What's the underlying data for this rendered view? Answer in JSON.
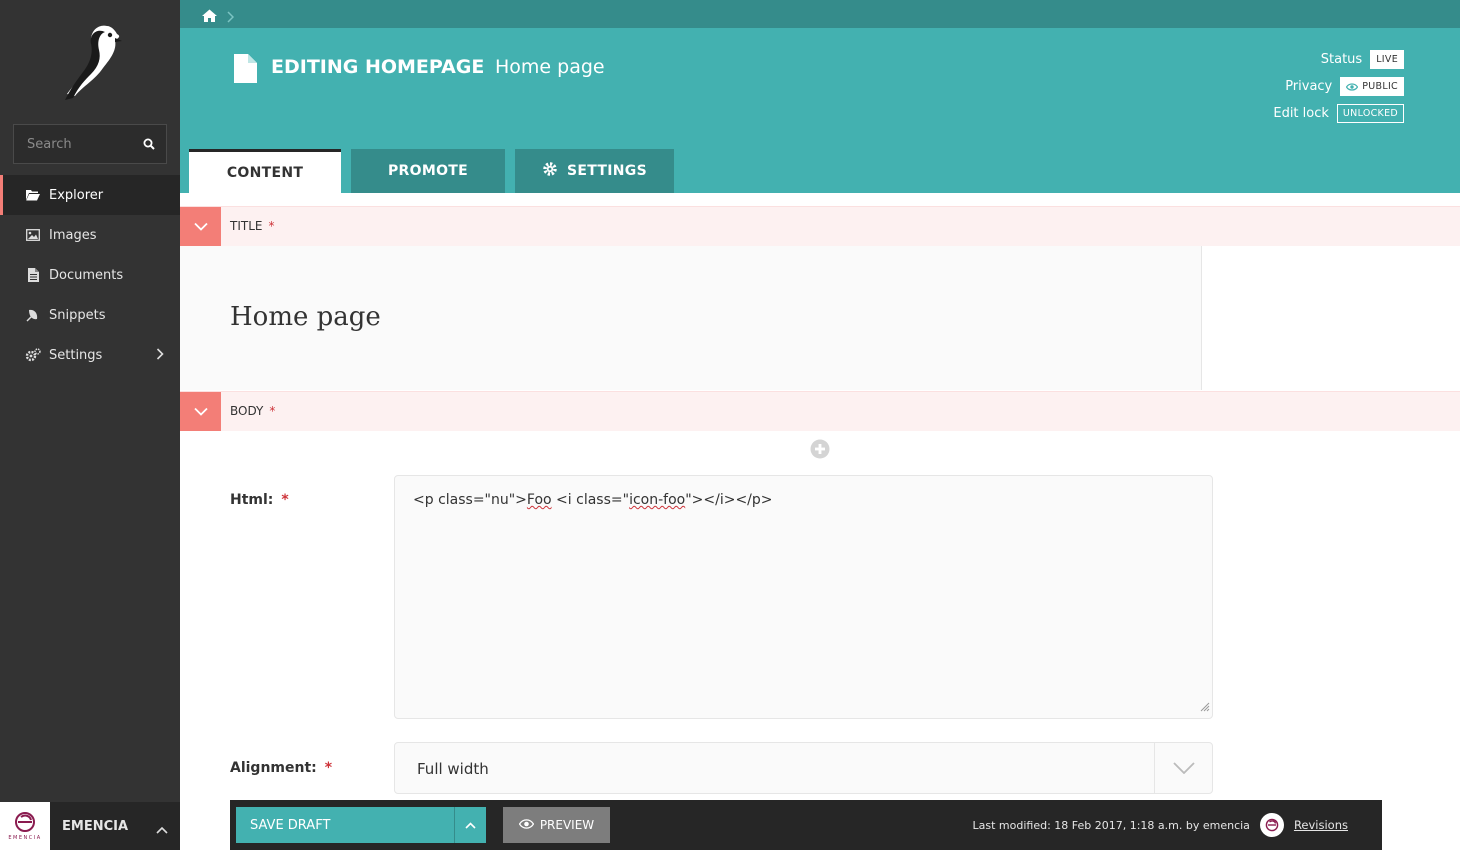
{
  "sidebar": {
    "search_placeholder": "Search",
    "items": [
      {
        "label": "Explorer",
        "icon": "folder-open-icon"
      },
      {
        "label": "Images",
        "icon": "image-icon"
      },
      {
        "label": "Documents",
        "icon": "document-icon"
      },
      {
        "label": "Snippets",
        "icon": "snippet-icon"
      },
      {
        "label": "Settings",
        "icon": "cogs-icon"
      }
    ],
    "account": {
      "name": "EMENCIA",
      "brand": "EMENCIA"
    }
  },
  "header": {
    "title_strong": "EDITING HOMEPAGE",
    "title_light": "Home page",
    "status_label": "Status",
    "status_value": "LIVE",
    "privacy_label": "Privacy",
    "privacy_value": "PUBLIC",
    "lock_label": "Edit lock",
    "lock_value": "UNLOCKED",
    "tabs": [
      {
        "label": "CONTENT",
        "active": true
      },
      {
        "label": "PROMOTE",
        "active": false
      },
      {
        "label": "SETTINGS",
        "active": false
      }
    ]
  },
  "content": {
    "title_section": "TITLE",
    "title_value": "Home page",
    "body_section": "BODY",
    "required_marker": "*",
    "html_label": "Html:",
    "html_value_parts": [
      "<p class=\"nu\">",
      "Foo",
      " <i class=\"",
      "icon-foo",
      "\"></i></p>"
    ],
    "alignment_label": "Alignment:",
    "alignment_value": "Full width"
  },
  "footer": {
    "save_label": "SAVE DRAFT",
    "preview_label": "PREVIEW",
    "last_modified": "Last modified: 18 Feb 2017, 1:18 a.m. by emencia",
    "revisions_label": "Revisions"
  },
  "colors": {
    "primary_teal": "#43b1b0",
    "dark_teal": "#358c8b",
    "sidebar_bg": "#333333",
    "required_red": "#cd3238",
    "section_salmon": "#f37e77"
  }
}
